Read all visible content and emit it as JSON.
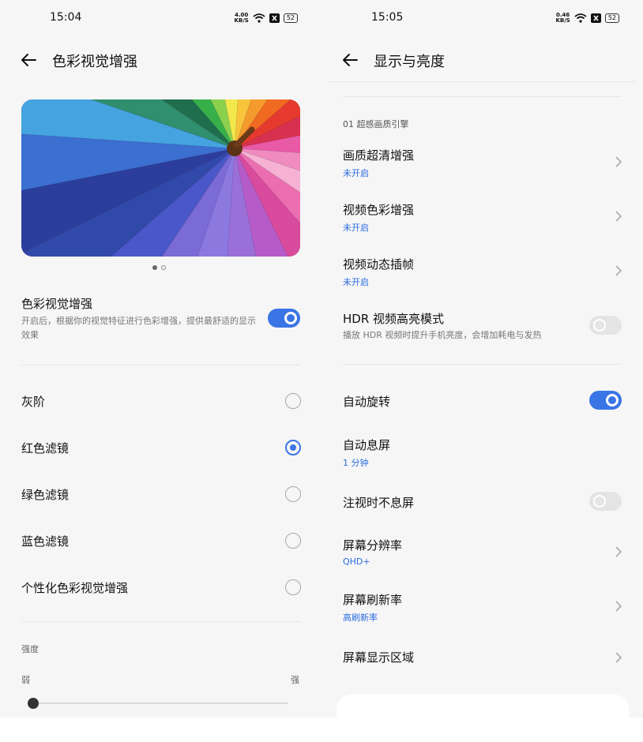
{
  "left": {
    "status": {
      "time": "15:04",
      "netspeed_value": "4.00",
      "netspeed_unit": "KB/S",
      "battery": "52"
    },
    "title": "色彩视觉增强",
    "feature": {
      "title": "色彩视觉增强",
      "desc": "开启后，根据你的视觉特征进行色彩增强，提供最舒适的显示效果",
      "enabled": true
    },
    "options": [
      {
        "label": "灰阶",
        "selected": false
      },
      {
        "label": "红色滤镜",
        "selected": true
      },
      {
        "label": "绿色滤镜",
        "selected": false
      },
      {
        "label": "蓝色滤镜",
        "selected": false
      },
      {
        "label": "个性化色彩视觉增强",
        "selected": false
      }
    ],
    "intensity": {
      "label": "强度",
      "min_label": "弱",
      "max_label": "强",
      "value": 0.0
    }
  },
  "right": {
    "status": {
      "time": "15:05",
      "netspeed_value": "0.46",
      "netspeed_unit": "KB/S",
      "battery": "52"
    },
    "title": "显示与亮度",
    "section": "01 超感画质引擎",
    "items": [
      {
        "title": "画质超清增强",
        "status": "未开启",
        "control": "chevron"
      },
      {
        "title": "视频色彩增强",
        "status": "未开启",
        "control": "chevron"
      },
      {
        "title": "视频动态插帧",
        "status": "未开启",
        "control": "chevron"
      },
      {
        "title": "HDR 视频高亮模式",
        "desc": "播放 HDR 视频时提升手机亮度，会增加耗电与发热",
        "control": "toggle",
        "enabled": false
      },
      {
        "title": "自动旋转",
        "control": "toggle",
        "enabled": true
      },
      {
        "title": "自动息屏",
        "status": "1 分钟",
        "control": "none"
      },
      {
        "title": "注视时不息屏",
        "control": "toggle",
        "enabled": false
      },
      {
        "title": "屏幕分辨率",
        "status": "QHD+",
        "control": "chevron"
      },
      {
        "title": "屏幕刷新率",
        "status": "高刷新率",
        "control": "chevron"
      },
      {
        "title": "屏幕显示区域",
        "control": "chevron"
      }
    ]
  },
  "colors": {
    "accent": "#3a75e6",
    "status_link": "#2a6bdf"
  }
}
